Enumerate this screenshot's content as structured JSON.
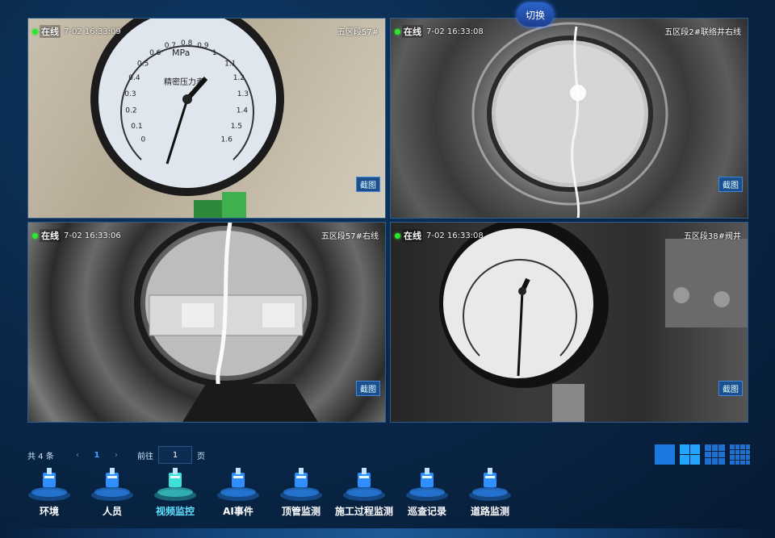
{
  "switch_button": "切换",
  "cameras": [
    {
      "status": "在线",
      "timestamp": "7-02  16:33:09",
      "location": "五区段57#",
      "snapshot": "截图"
    },
    {
      "status": "在线",
      "timestamp": "7-02  16:33:08",
      "location": "五区段2#联络井右线",
      "snapshot": "截图"
    },
    {
      "status": "在线",
      "timestamp": "7-02  16:33:06",
      "location": "五区段57#右线",
      "snapshot": "截图"
    },
    {
      "status": "在线",
      "timestamp": "7-02  16:33:08",
      "location": "五区段38#阀井",
      "snapshot": "截图"
    }
  ],
  "pagination": {
    "total": "共 4 条",
    "prev": "‹",
    "current": "1",
    "next": "›",
    "goto_label": "前往",
    "goto_value": "1",
    "page_suffix": "页"
  },
  "nav": [
    {
      "label": "环境",
      "icon": "environment-icon",
      "active": false
    },
    {
      "label": "人员",
      "icon": "personnel-icon",
      "active": false
    },
    {
      "label": "视频监控",
      "icon": "video-monitor-icon",
      "active": true
    },
    {
      "label": "AI事件",
      "icon": "ai-event-icon",
      "active": false
    },
    {
      "label": "顶管监测",
      "icon": "pipe-jacking-icon",
      "active": false
    },
    {
      "label": "施工过程监测",
      "icon": "construction-process-icon",
      "active": false
    },
    {
      "label": "巡查记录",
      "icon": "patrol-record-icon",
      "active": false
    },
    {
      "label": "道路监测",
      "icon": "road-monitor-icon",
      "active": false
    }
  ],
  "gauge": {
    "unit": "MPa",
    "dial_name": "精密压力表",
    "ticks": [
      "0",
      "0.1",
      "0.2",
      "0.3",
      "0.4",
      "0.5",
      "0.6",
      "0.7",
      "0.8",
      "0.9",
      "1",
      "1.1",
      "1.2",
      "1.3",
      "1.4",
      "1.5",
      "1.6"
    ]
  },
  "colors": {
    "accent": "#41a3ff",
    "online": "#2ee62e",
    "active_nav": "#5fe2ff"
  }
}
